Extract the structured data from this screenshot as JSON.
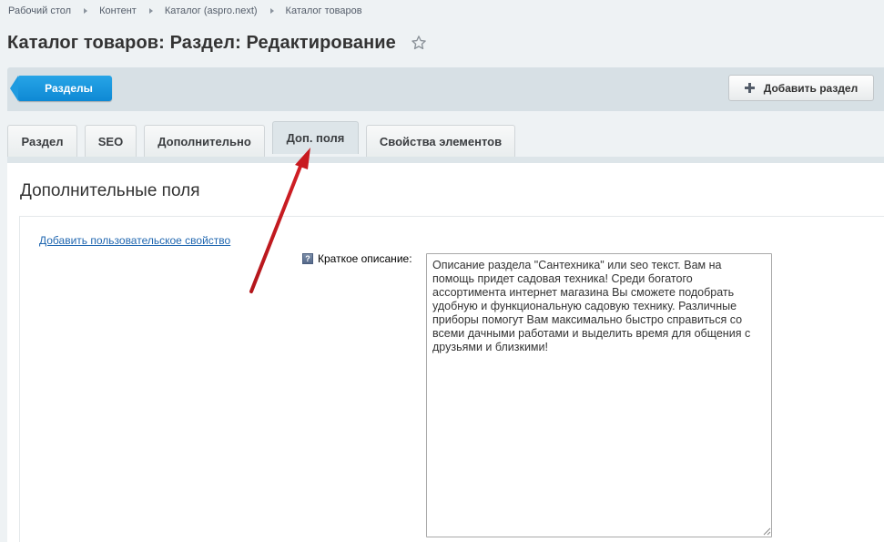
{
  "breadcrumb": [
    {
      "label": "Рабочий стол"
    },
    {
      "label": "Контент"
    },
    {
      "label": "Каталог (aspro.next)"
    },
    {
      "label": "Каталог товаров"
    }
  ],
  "page_title": "Каталог товаров: Раздел: Редактирование",
  "toolbar": {
    "sections_button": "Разделы",
    "add_section_button": "Добавить раздел"
  },
  "tabs": [
    {
      "label": "Раздел"
    },
    {
      "label": "SEO"
    },
    {
      "label": "Дополнительно"
    },
    {
      "label": "Доп. поля",
      "active": true
    },
    {
      "label": "Свойства элементов"
    }
  ],
  "section": {
    "title": "Дополнительные поля",
    "add_property_link": "Добавить пользовательское свойство",
    "field_label": "Краткое описание:",
    "field_value": "Описание раздела \"Сантехника\" или seo текст. Вам на помощь придет садовая техника! Среди богатого ассортимента интернет магазина Вы сможете подобрать удобную и функциональную садовую технику. Различные приборы помогут Вам максимально быстро справиться со всеми дачными работами и выделить время для общения с друзьями и близкими!"
  },
  "colors": {
    "primary_button": "#1b97df",
    "link": "#2067b0",
    "annotation_arrow": "#c0191e"
  }
}
